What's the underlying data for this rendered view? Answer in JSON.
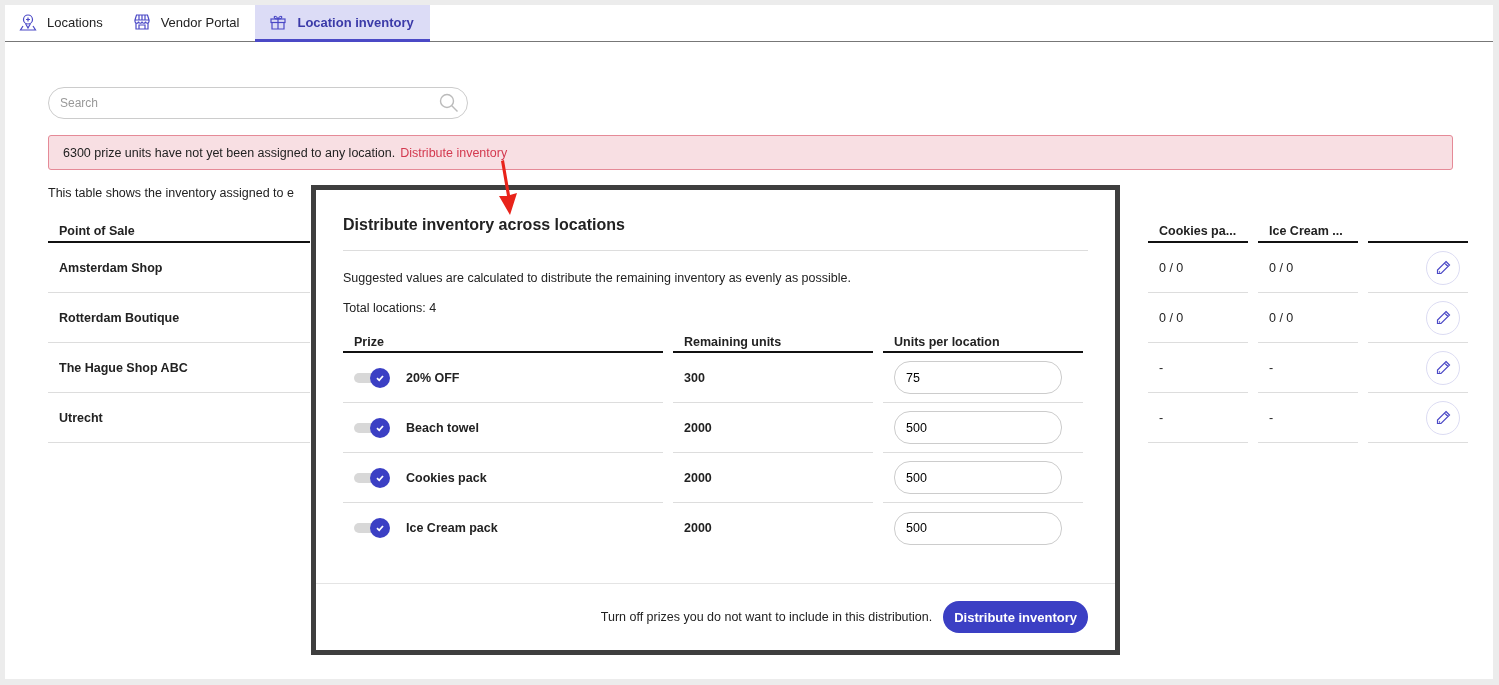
{
  "tabs": [
    {
      "label": "Locations",
      "selected": false
    },
    {
      "label": "Vendor Portal",
      "selected": false
    },
    {
      "label": "Location inventory",
      "selected": true
    }
  ],
  "search": {
    "placeholder": "Search"
  },
  "alert": {
    "text": "6300 prize units have not yet been assigned to any location.",
    "link": "Distribute inventory"
  },
  "description": "This table shows the inventory assigned to e",
  "table": {
    "columns": [
      "Point of Sale",
      "Cookies pa...",
      "Ice Cream ..."
    ],
    "rows": [
      {
        "name": "Amsterdam Shop",
        "cookies": "0 / 0",
        "ice_cream": "0 / 0"
      },
      {
        "name": "Rotterdam Boutique",
        "cookies": "0 / 0",
        "ice_cream": "0 / 0"
      },
      {
        "name": "The Hague Shop ABC",
        "cookies": "-",
        "ice_cream": "-"
      },
      {
        "name": "Utrecht",
        "cookies": "-",
        "ice_cream": "-"
      }
    ]
  },
  "dialog": {
    "title": "Distribute inventory across locations",
    "intro": "Suggested values are calculated to distribute the remaining inventory as evenly as possible.",
    "total": "Total locations: 4",
    "columns": [
      "Prize",
      "Remaining units",
      "Units per location"
    ],
    "prizes": [
      {
        "name": "20% OFF",
        "enabled": true,
        "remaining": "300",
        "units": "75"
      },
      {
        "name": "Beach towel",
        "enabled": true,
        "remaining": "2000",
        "units": "500"
      },
      {
        "name": "Cookies pack",
        "enabled": true,
        "remaining": "2000",
        "units": "500"
      },
      {
        "name": "Ice Cream pack",
        "enabled": true,
        "remaining": "2000",
        "units": "500"
      }
    ],
    "footer_note": "Turn off prizes you do not want to include in this distribution.",
    "button": "Distribute inventory"
  }
}
